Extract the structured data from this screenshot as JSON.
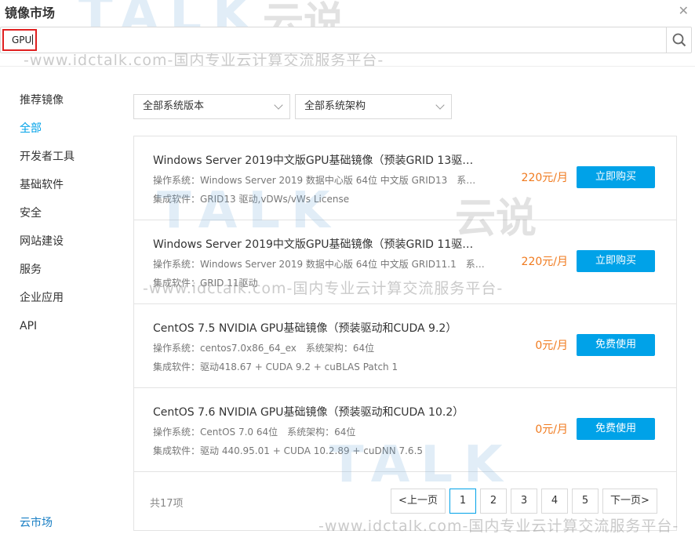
{
  "window": {
    "title": "镜像市场",
    "close_icon": "close-icon"
  },
  "search": {
    "value": "GPU",
    "search_icon": "search-icon"
  },
  "sidebar": {
    "items": [
      {
        "label": "推荐镜像",
        "active": false
      },
      {
        "label": "全部",
        "active": true
      },
      {
        "label": "开发者工具",
        "active": false
      },
      {
        "label": "基础软件",
        "active": false
      },
      {
        "label": "安全",
        "active": false
      },
      {
        "label": "网站建设",
        "active": false
      },
      {
        "label": "服务",
        "active": false
      },
      {
        "label": "企业应用",
        "active": false
      },
      {
        "label": "API",
        "active": false
      }
    ],
    "footer": "云市场"
  },
  "filters": {
    "version": "全部系统版本",
    "arch": "全部系统架构"
  },
  "products": [
    {
      "title": "Windows Server 2019中文版GPU基础镜像（预装GRID 13驱…",
      "os": "操作系统：Windows Server 2019 数据中心版 64位 中文版 GRID13　系…",
      "software": "集成软件：GRID13 驱动,vDWs/vWs License",
      "price": "220元/月",
      "button": "立即购买"
    },
    {
      "title": "Windows Server 2019中文版GPU基础镜像（预装GRID 11驱…",
      "os": "操作系统：Windows Server 2019 数据中心版 64位 中文版 GRID11.1　系…",
      "software": "集成软件：GRID 11驱动",
      "price": "220元/月",
      "button": "立即购买"
    },
    {
      "title": "CentOS 7.5 NVIDIA GPU基础镜像（预装驱动和CUDA 9.2）",
      "os": "操作系统：centos7.0x86_64_ex　系统架构：64位",
      "software": "集成软件：驱动418.67 + CUDA 9.2 + cuBLAS Patch 1",
      "price": "0元/月",
      "button": "免费使用"
    },
    {
      "title": "CentOS 7.6 NVIDIA GPU基础镜像（预装驱动和CUDA 10.2）",
      "os": "操作系统：CentOS 7.0 64位　系统架构：64位",
      "software": "集成软件：驱动 440.95.01 + CUDA 10.2.89 + cuDNN 7.6.5",
      "price": "0元/月",
      "button": "免费使用"
    }
  ],
  "pagination": {
    "total": "共17项",
    "prev": "<上一页",
    "pages": [
      "1",
      "2",
      "3",
      "4",
      "5"
    ],
    "current": "1",
    "next": "下一页>"
  },
  "watermark": {
    "brand": "TALK",
    "brand_cn": "云说",
    "url": "-www.idctalk.com-国内专业云计算交流服务平台-"
  },
  "colors": {
    "accent": "#00a2e8",
    "price": "#f07a1e",
    "highlight_box": "#e02020"
  }
}
